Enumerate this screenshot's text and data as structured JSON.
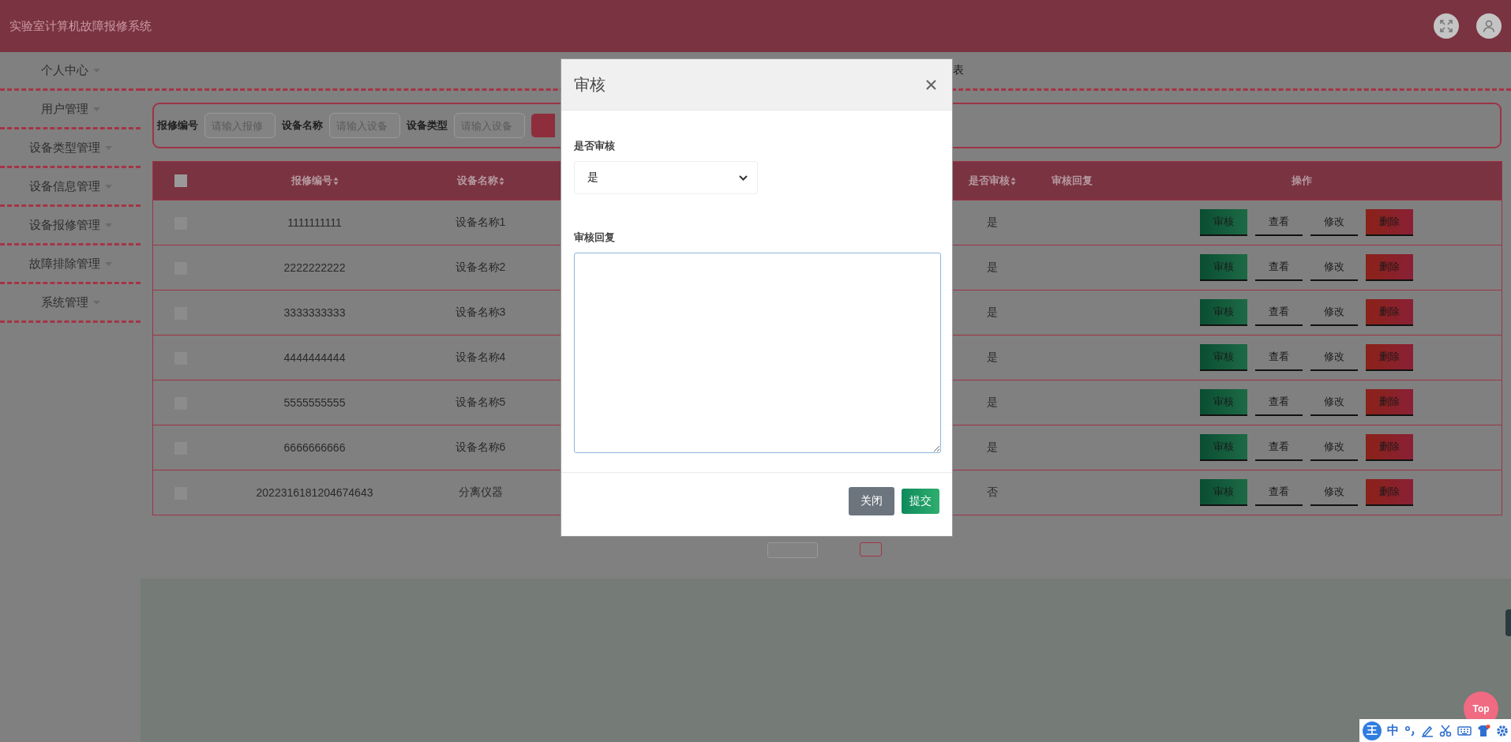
{
  "app": {
    "title": "实验室计算机故障报修系统"
  },
  "sidebar": {
    "items": [
      {
        "label": "个人中心"
      },
      {
        "label": "用户管理"
      },
      {
        "label": "设备类型管理"
      },
      {
        "label": "设备信息管理"
      },
      {
        "label": "设备报修管理"
      },
      {
        "label": "故障排除管理"
      },
      {
        "label": "系统管理"
      }
    ]
  },
  "breadcrumb": {
    "text": "表"
  },
  "search": {
    "fields": [
      {
        "label": "报修编号",
        "placeholder": "请输入报修"
      },
      {
        "label": "设备名称",
        "placeholder": "请输入设备"
      },
      {
        "label": "设备类型",
        "placeholder": "请输入设备"
      }
    ]
  },
  "table": {
    "select_all": false,
    "columns": [
      {
        "label": "报修编号",
        "sortable": true
      },
      {
        "label": "设备名称",
        "sortable": true
      },
      {
        "label": "是否审核",
        "sortable": true
      },
      {
        "label": "审核回复",
        "sortable": false
      },
      {
        "label": "操作",
        "sortable": false
      }
    ],
    "rows": [
      {
        "selected": false,
        "repair_no": "1111111111",
        "device_name": "设备名称1",
        "reviewed": "是",
        "actions": [
          {
            "kind": "review",
            "label": "审核"
          },
          {
            "kind": "plain",
            "label": "查看"
          },
          {
            "kind": "plain",
            "label": "修改"
          },
          {
            "kind": "danger",
            "label": "删除"
          }
        ]
      },
      {
        "selected": false,
        "repair_no": "2222222222",
        "device_name": "设备名称2",
        "reviewed": "是",
        "actions": [
          {
            "kind": "review",
            "label": "审核"
          },
          {
            "kind": "plain",
            "label": "查看"
          },
          {
            "kind": "plain",
            "label": "修改"
          },
          {
            "kind": "danger",
            "label": "删除"
          }
        ]
      },
      {
        "selected": false,
        "repair_no": "3333333333",
        "device_name": "设备名称3",
        "reviewed": "是",
        "actions": [
          {
            "kind": "review",
            "label": "审核"
          },
          {
            "kind": "plain",
            "label": "查看"
          },
          {
            "kind": "plain",
            "label": "修改"
          },
          {
            "kind": "danger",
            "label": "删除"
          }
        ]
      },
      {
        "selected": false,
        "repair_no": "4444444444",
        "device_name": "设备名称4",
        "reviewed": "是",
        "actions": [
          {
            "kind": "review",
            "label": "审核"
          },
          {
            "kind": "plain",
            "label": "查看"
          },
          {
            "kind": "plain",
            "label": "修改"
          },
          {
            "kind": "danger",
            "label": "删除"
          }
        ]
      },
      {
        "selected": false,
        "repair_no": "5555555555",
        "device_name": "设备名称5",
        "reviewed": "是",
        "actions": [
          {
            "kind": "review",
            "label": "审核"
          },
          {
            "kind": "plain",
            "label": "查看"
          },
          {
            "kind": "plain",
            "label": "修改"
          },
          {
            "kind": "danger",
            "label": "删除"
          }
        ]
      },
      {
        "selected": false,
        "repair_no": "6666666666",
        "device_name": "设备名称6",
        "reviewed": "是",
        "actions": [
          {
            "kind": "review",
            "label": "审核"
          },
          {
            "kind": "plain",
            "label": "查看"
          },
          {
            "kind": "plain",
            "label": "修改"
          },
          {
            "kind": "danger",
            "label": "删除"
          }
        ]
      },
      {
        "selected": false,
        "repair_no": "2022316181204674643",
        "device_name": "分离仪器",
        "reviewed": "否",
        "actions": [
          {
            "kind": "review",
            "label": "审核"
          },
          {
            "kind": "plain",
            "label": "查看"
          },
          {
            "kind": "plain",
            "label": "修改"
          },
          {
            "kind": "danger",
            "label": "删除"
          }
        ]
      }
    ]
  },
  "modal": {
    "title": "审核",
    "fields": [
      {
        "kind": "select",
        "label": "是否审核",
        "value": "是"
      },
      {
        "kind": "textarea",
        "label": "审核回复"
      }
    ],
    "buttons": [
      {
        "kind": "secondary",
        "label": "关闭"
      },
      {
        "kind": "primary",
        "label": "提交"
      }
    ]
  },
  "back_to_top": {
    "label": "Top"
  },
  "ime_toolbar": {
    "logo": "王",
    "mode": "中"
  }
}
